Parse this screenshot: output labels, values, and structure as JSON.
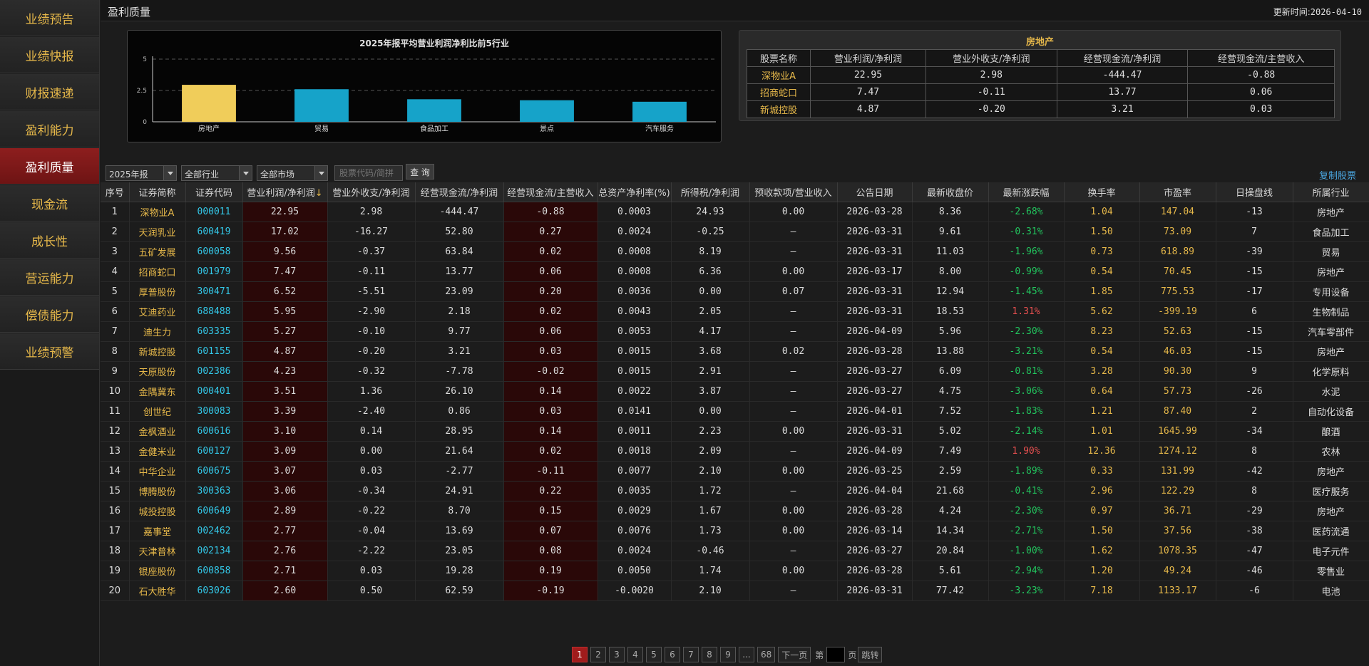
{
  "sidebar": {
    "items": [
      {
        "label": "业绩预告"
      },
      {
        "label": "业绩快报"
      },
      {
        "label": "财报速递"
      },
      {
        "label": "盈利能力"
      },
      {
        "label": "盈利质量"
      },
      {
        "label": "现金流"
      },
      {
        "label": "成长性"
      },
      {
        "label": "营运能力"
      },
      {
        "label": "偿债能力"
      },
      {
        "label": "业绩预警"
      }
    ],
    "active_index": 4
  },
  "header": {
    "title": "盈利质量",
    "update_label": "更新时间:",
    "update_time": "2026-04-10"
  },
  "chart_data": {
    "type": "bar",
    "title": "2025年报平均营业利润净利比前5行业",
    "categories": [
      "房地产",
      "贸易",
      "食品加工",
      "景点",
      "汽车服务"
    ],
    "values": [
      2.95,
      2.6,
      1.8,
      1.72,
      1.6
    ],
    "ylim": [
      0,
      5
    ],
    "yticks": [
      "0",
      "2.5",
      "5"
    ],
    "highlight_color": "#f0cd5a",
    "bar_color": "#16a3c9",
    "grid": true
  },
  "detail": {
    "title": "房地产",
    "headers": [
      "股票名称",
      "营业利润/净利润",
      "营业外收支/净利润",
      "经营现金流/净利润",
      "经营现金流/主营收入"
    ],
    "rows": [
      [
        "深物业A",
        "22.95",
        "2.98",
        "-444.47",
        "-0.88"
      ],
      [
        "招商蛇口",
        "7.47",
        "-0.11",
        "13.77",
        "0.06"
      ],
      [
        "新城控股",
        "4.87",
        "-0.20",
        "3.21",
        "0.03"
      ]
    ]
  },
  "filters": {
    "period": "2025年报",
    "industry": "全部行业",
    "market": "全部市场",
    "search_placeholder": "股票代码/简拼",
    "query_button": "查 询",
    "copy_link": "复制股票"
  },
  "table": {
    "headers": [
      "序号",
      "证券简称",
      "证券代码",
      "营业利润/净利润",
      "营业外收支/净利润",
      "经营现金流/净利润",
      "经营现金流/主营收入",
      "总资产净利率(%)",
      "所得税/净利润",
      "预收款项/营业收入",
      "公告日期",
      "最新收盘价",
      "最新涨跌幅",
      "换手率",
      "市盈率",
      "日操盘线",
      "所属行业"
    ],
    "sort_arrow": "↓",
    "rows": [
      [
        "1",
        "深物业A",
        "000011",
        "22.95",
        "2.98",
        "-444.47",
        "-0.88",
        "0.0003",
        "24.93",
        "0.00",
        "2026-03-28",
        "8.36",
        "-2.68%",
        "1.04",
        "147.04",
        "-13",
        "房地产"
      ],
      [
        "2",
        "天润乳业",
        "600419",
        "17.02",
        "-16.27",
        "52.80",
        "0.27",
        "0.0024",
        "-0.25",
        "—",
        "2026-03-31",
        "9.61",
        "-0.31%",
        "1.50",
        "73.09",
        "7",
        "食品加工"
      ],
      [
        "3",
        "五矿发展",
        "600058",
        "9.56",
        "-0.37",
        "63.84",
        "0.02",
        "0.0008",
        "8.19",
        "—",
        "2026-03-31",
        "11.03",
        "-1.96%",
        "0.73",
        "618.89",
        "-39",
        "贸易"
      ],
      [
        "4",
        "招商蛇口",
        "001979",
        "7.47",
        "-0.11",
        "13.77",
        "0.06",
        "0.0008",
        "6.36",
        "0.00",
        "2026-03-17",
        "8.00",
        "-0.99%",
        "0.54",
        "70.45",
        "-15",
        "房地产"
      ],
      [
        "5",
        "厚普股份",
        "300471",
        "6.52",
        "-5.51",
        "23.09",
        "0.20",
        "0.0036",
        "0.00",
        "0.07",
        "2026-03-31",
        "12.94",
        "-1.45%",
        "1.85",
        "775.53",
        "-17",
        "专用设备"
      ],
      [
        "6",
        "艾迪药业",
        "688488",
        "5.95",
        "-2.90",
        "2.18",
        "0.02",
        "0.0043",
        "2.05",
        "—",
        "2026-03-31",
        "18.53",
        "1.31%",
        "5.62",
        "-399.19",
        "6",
        "生物制品"
      ],
      [
        "7",
        "迪生力",
        "603335",
        "5.27",
        "-0.10",
        "9.77",
        "0.06",
        "0.0053",
        "4.17",
        "—",
        "2026-04-09",
        "5.96",
        "-2.30%",
        "8.23",
        "52.63",
        "-15",
        "汽车零部件"
      ],
      [
        "8",
        "新城控股",
        "601155",
        "4.87",
        "-0.20",
        "3.21",
        "0.03",
        "0.0015",
        "3.68",
        "0.02",
        "2026-03-28",
        "13.88",
        "-3.21%",
        "0.54",
        "46.03",
        "-15",
        "房地产"
      ],
      [
        "9",
        "天原股份",
        "002386",
        "4.23",
        "-0.32",
        "-7.78",
        "-0.02",
        "0.0015",
        "2.91",
        "—",
        "2026-03-27",
        "6.09",
        "-0.81%",
        "3.28",
        "90.30",
        "9",
        "化学原料"
      ],
      [
        "10",
        "金隅冀东",
        "000401",
        "3.51",
        "1.36",
        "26.10",
        "0.14",
        "0.0022",
        "3.87",
        "—",
        "2026-03-27",
        "4.75",
        "-3.06%",
        "0.64",
        "57.73",
        "-26",
        "水泥"
      ],
      [
        "11",
        "创世纪",
        "300083",
        "3.39",
        "-2.40",
        "0.86",
        "0.03",
        "0.0141",
        "0.00",
        "—",
        "2026-04-01",
        "7.52",
        "-1.83%",
        "1.21",
        "87.40",
        "2",
        "自动化设备"
      ],
      [
        "12",
        "金枫酒业",
        "600616",
        "3.10",
        "0.14",
        "28.95",
        "0.14",
        "0.0011",
        "2.23",
        "0.00",
        "2026-03-31",
        "5.02",
        "-2.14%",
        "1.01",
        "1645.99",
        "-34",
        "酿酒"
      ],
      [
        "13",
        "金健米业",
        "600127",
        "3.09",
        "0.00",
        "21.64",
        "0.02",
        "0.0018",
        "2.09",
        "—",
        "2026-04-09",
        "7.49",
        "1.90%",
        "12.36",
        "1274.12",
        "8",
        "农林"
      ],
      [
        "14",
        "中华企业",
        "600675",
        "3.07",
        "0.03",
        "-2.77",
        "-0.11",
        "0.0077",
        "2.10",
        "0.00",
        "2026-03-25",
        "2.59",
        "-1.89%",
        "0.33",
        "131.99",
        "-42",
        "房地产"
      ],
      [
        "15",
        "博腾股份",
        "300363",
        "3.06",
        "-0.34",
        "24.91",
        "0.22",
        "0.0035",
        "1.72",
        "—",
        "2026-04-04",
        "21.68",
        "-0.41%",
        "2.96",
        "122.29",
        "8",
        "医疗服务"
      ],
      [
        "16",
        "城投控股",
        "600649",
        "2.89",
        "-0.22",
        "8.70",
        "0.15",
        "0.0029",
        "1.67",
        "0.00",
        "2026-03-28",
        "4.24",
        "-2.30%",
        "0.97",
        "36.71",
        "-29",
        "房地产"
      ],
      [
        "17",
        "嘉事堂",
        "002462",
        "2.77",
        "-0.04",
        "13.69",
        "0.07",
        "0.0076",
        "1.73",
        "0.00",
        "2026-03-14",
        "14.34",
        "-2.71%",
        "1.50",
        "37.56",
        "-38",
        "医药流通"
      ],
      [
        "18",
        "天津普林",
        "002134",
        "2.76",
        "-2.22",
        "23.05",
        "0.08",
        "0.0024",
        "-0.46",
        "—",
        "2026-03-27",
        "20.84",
        "-1.00%",
        "1.62",
        "1078.35",
        "-47",
        "电子元件"
      ],
      [
        "19",
        "银座股份",
        "600858",
        "2.71",
        "0.03",
        "19.28",
        "0.19",
        "0.0050",
        "1.74",
        "0.00",
        "2026-03-28",
        "5.61",
        "-2.94%",
        "1.20",
        "49.24",
        "-46",
        "零售业"
      ],
      [
        "20",
        "石大胜华",
        "603026",
        "2.60",
        "0.50",
        "62.59",
        "-0.19",
        "-0.0020",
        "2.10",
        "—",
        "2026-03-31",
        "77.42",
        "-3.23%",
        "7.18",
        "1133.17",
        "-6",
        "电池"
      ]
    ]
  },
  "pagination": {
    "pages": [
      "1",
      "2",
      "3",
      "4",
      "5",
      "6",
      "7",
      "8",
      "9",
      "...",
      "68"
    ],
    "current": "1",
    "next": "下一页",
    "goto_prefix": "第",
    "goto_suffix": "页",
    "goto_button": "跳转"
  },
  "colors": {
    "accent_gold": "#e6b84a",
    "active_red": "#8d1e1e",
    "code_cyan": "#33c8e8",
    "up_red": "#e85050",
    "down_green": "#22c55e"
  }
}
